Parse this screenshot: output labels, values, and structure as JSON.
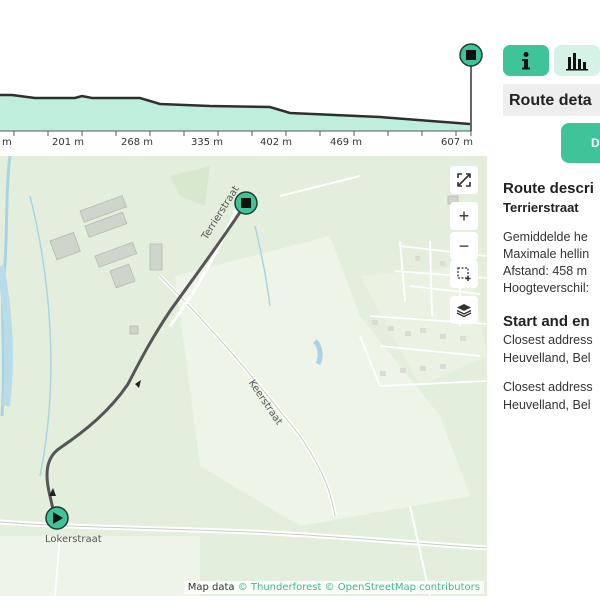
{
  "elevation": {
    "ticks": [
      "m",
      "201 m",
      "268 m",
      "335 m",
      "402 m",
      "469 m",
      "607 m"
    ]
  },
  "map": {
    "streets": {
      "terrierstraat": "Terrierstraat",
      "keerstraat": "Keerstraat",
      "lokerstraat": "Lokerstraat"
    },
    "attribution": {
      "prefix": "Map data ",
      "thunderforest": "© Thunderforest",
      "osm": "© OpenStreetMap contributors"
    },
    "controls": {
      "zoom_in": "+",
      "zoom_out": "−"
    }
  },
  "panel": {
    "title": "Route deta",
    "button_label": "D",
    "description_heading": "Route descri",
    "street_name": "Terrierstraat",
    "stats": [
      "Gemiddelde he",
      "Maximale hellin",
      "Afstand: 458 m",
      "Hoogteverschil:"
    ],
    "start_end_heading": "Start and en",
    "start_address_label": "Closest address",
    "start_address_place": "Heuvelland, Bel",
    "end_address_label": "Closest address",
    "end_address_place": "Heuvelland, Bel"
  },
  "colors": {
    "accent": "#3fc49a",
    "accent_light": "#d6f2e6",
    "profile_fill": "#bfeedd",
    "map_bg": "#e3efdc"
  }
}
